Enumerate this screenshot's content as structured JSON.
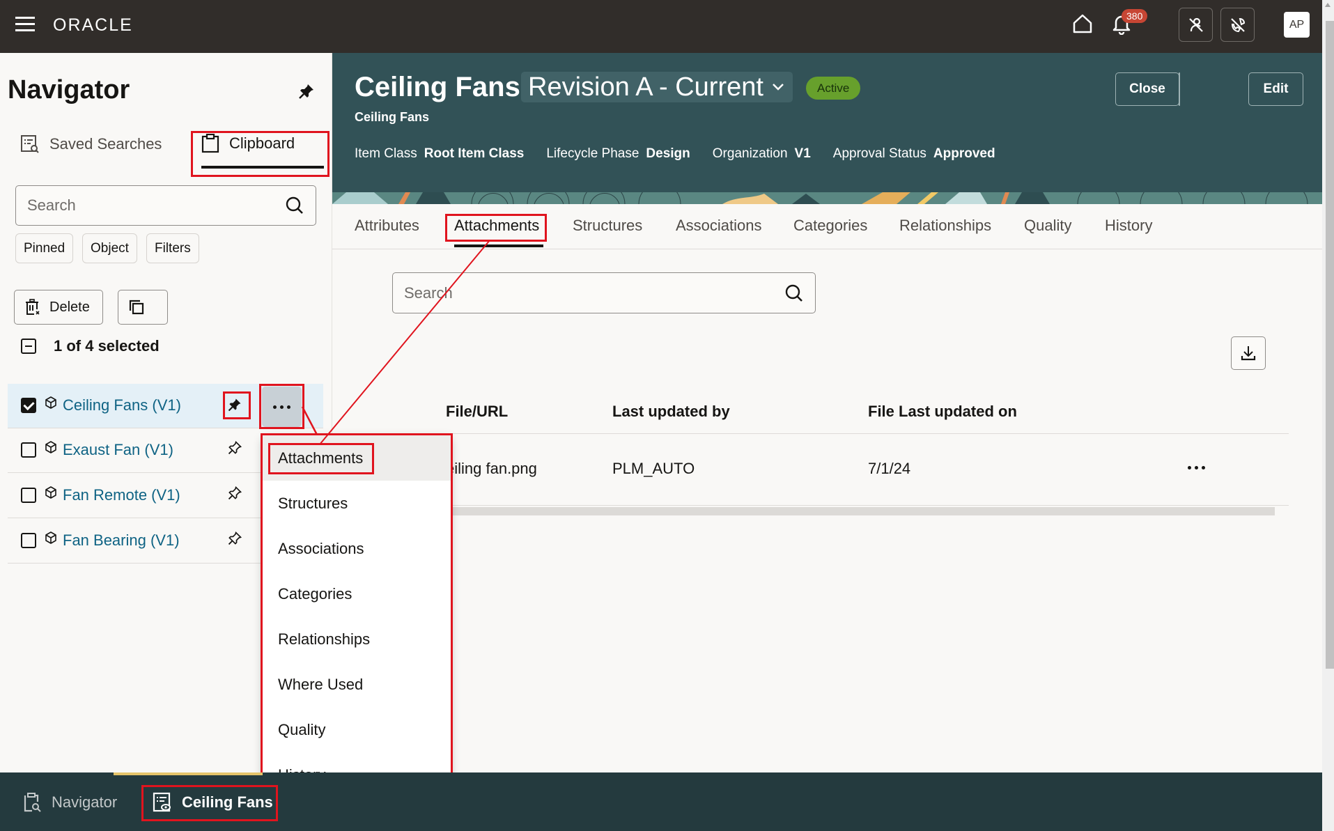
{
  "topbar": {
    "logo": "ORACLE",
    "notification_count": "380",
    "avatar_initials": "AP",
    "icons": [
      "menu-icon",
      "home-icon",
      "bell-icon",
      "person-off-icon",
      "phone-off-icon"
    ]
  },
  "navigator": {
    "title": "Navigator",
    "tabs": [
      {
        "label": "Saved Searches",
        "icon": "saved-search-icon",
        "active": false
      },
      {
        "label": "Clipboard",
        "icon": "clipboard-icon",
        "active": true
      }
    ],
    "search_placeholder": "Search",
    "filter_chips": [
      "Pinned",
      "Object",
      "Filters"
    ],
    "delete_label": "Delete",
    "selection_text": "1 of 4 selected",
    "items": [
      {
        "label": "Ceiling Fans (V1)",
        "checked": true,
        "pinned": true
      },
      {
        "label": "Exaust Fan (V1)",
        "checked": false,
        "pinned": false
      },
      {
        "label": "Fan Remote (V1)",
        "checked": false,
        "pinned": false
      },
      {
        "label": "Fan Bearing (V1)",
        "checked": false,
        "pinned": false
      }
    ]
  },
  "context_menu": {
    "items": [
      "Attachments",
      "Structures",
      "Associations",
      "Categories",
      "Relationships",
      "Where Used",
      "Quality",
      "History"
    ],
    "highlighted": "Attachments"
  },
  "item_header": {
    "title": "Ceiling Fans",
    "revision": "Revision A - Current",
    "status": "Active",
    "subtitle": "Ceiling Fans",
    "metadata": [
      {
        "label": "Item Class",
        "value": "Root Item Class"
      },
      {
        "label": "Lifecycle Phase",
        "value": "Design"
      },
      {
        "label": "Organization",
        "value": "V1"
      },
      {
        "label": "Approval Status",
        "value": "Approved"
      }
    ],
    "close_label": "Close",
    "edit_label": "Edit",
    "status_color": "#67a02c"
  },
  "tabs": {
    "items": [
      "Attributes",
      "Attachments",
      "Structures",
      "Associations",
      "Categories",
      "Relationships",
      "Quality",
      "History"
    ],
    "active": "Attachments"
  },
  "attachments": {
    "search_placeholder": "Search",
    "columns": [
      "File/URL",
      "Last updated by",
      "File Last updated on"
    ],
    "rows": [
      {
        "file": "Ceiling fan.png",
        "file_visible": "eiling fan.png",
        "updated_by": "PLM_AUTO",
        "updated_on": "7/1/24"
      }
    ]
  },
  "bottom_bar": {
    "navigator_label": "Navigator",
    "open_item_label": "Ceiling Fans"
  },
  "annotation_color": "#e0141e"
}
